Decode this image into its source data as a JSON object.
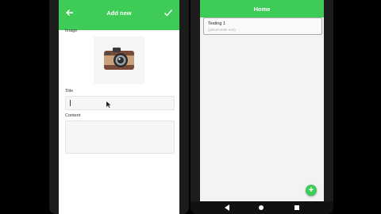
{
  "add_screen": {
    "title": "Add new",
    "image_label": "Image",
    "title_label": "Title",
    "title_value": "",
    "content_label": "Content",
    "content_value": "",
    "icons": [
      "back-arrow-icon",
      "check-icon",
      "camera-icon"
    ]
  },
  "home_screen": {
    "title": "Home",
    "notes": [
      {
        "title": "Testing 1",
        "subtitle": "(placeholder text)"
      }
    ],
    "fab_label": "+",
    "nav_icons": [
      "nav-back-icon",
      "nav-home-icon",
      "nav-recent-icon"
    ]
  },
  "colors": {
    "accent": "#3fcb57",
    "background": "#000000"
  }
}
